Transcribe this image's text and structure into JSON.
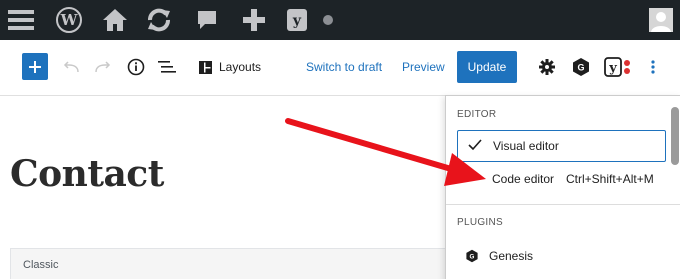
{
  "admin_bar": {
    "icons": [
      "menu-icon",
      "wordpress-logo-icon",
      "home-icon",
      "updates-icon",
      "comments-icon",
      "new-content-icon",
      "yoast-icon",
      "status-dot-icon",
      "user-avatar-icon"
    ]
  },
  "toolbar": {
    "layouts_label": "Layouts",
    "switch_to_draft_label": "Switch to draft",
    "preview_label": "Preview",
    "update_label": "Update",
    "icons": [
      "plus-icon",
      "undo-icon",
      "redo-icon",
      "info-icon",
      "list-view-icon",
      "layouts-icon",
      "settings-icon",
      "genesis-icon",
      "yoast-icon",
      "more-menu-icon"
    ]
  },
  "content": {
    "title": "Contact",
    "classic_block_label": "Classic"
  },
  "menu": {
    "editor_heading": "EDITOR",
    "items": [
      {
        "label": "Visual editor",
        "selected": true,
        "shortcut": ""
      },
      {
        "label": "Code editor",
        "selected": false,
        "shortcut": "Ctrl+Shift+Alt+M"
      }
    ],
    "plugins_heading": "PLUGINS",
    "plugins": [
      {
        "label": "Genesis",
        "icon": "genesis-icon"
      }
    ]
  },
  "colors": {
    "admin_bar": "#1d2327",
    "accent": "#1e72bd",
    "annotation_arrow": "#e8131b"
  }
}
